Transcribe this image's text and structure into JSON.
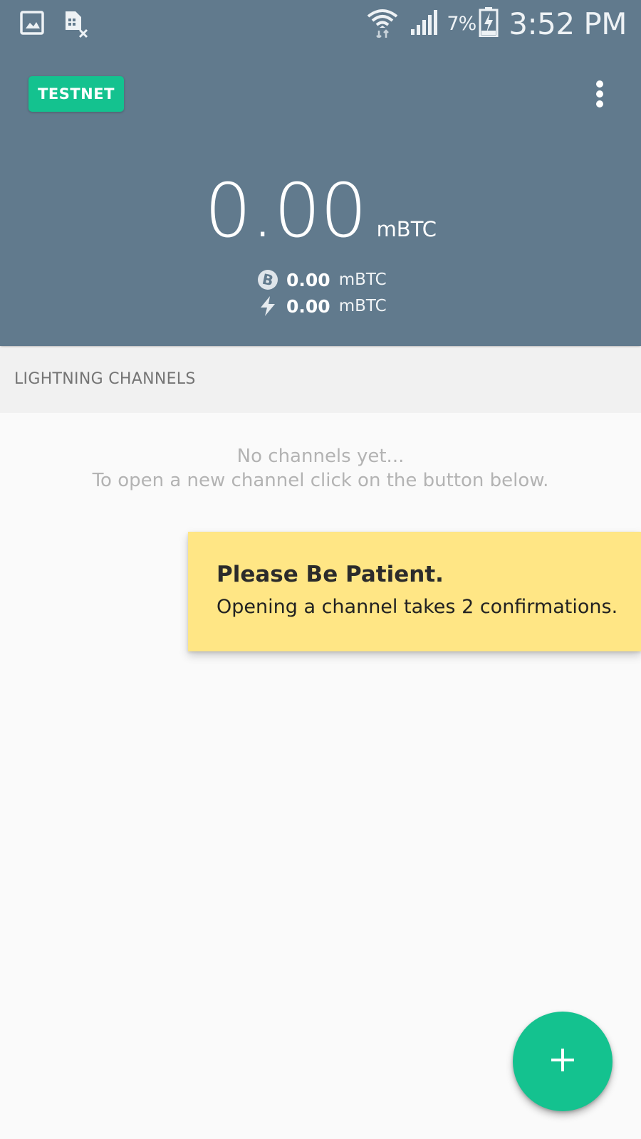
{
  "status_bar": {
    "left_icons": [
      "gallery-icon",
      "sim-card-off-icon"
    ],
    "right_icons": [
      "wifi-icon",
      "cell-signal-icon",
      "battery-charging-icon"
    ],
    "battery_percent": "7%",
    "time": "3:52 PM"
  },
  "header": {
    "network_badge": "TESTNET",
    "menu_icon": "more-vert-icon",
    "background_color": "#617a8d",
    "balance": {
      "value": "0.00",
      "unit": "mBTC"
    },
    "onchain": {
      "icon": "bitcoin-icon",
      "value": "0.00",
      "unit": "mBTC"
    },
    "lightning": {
      "icon": "lightning-bolt-icon",
      "value": "0.00",
      "unit": "mBTC"
    }
  },
  "channels": {
    "section_title": "LIGHTNING CHANNELS",
    "empty_line1": "No channels yet...",
    "empty_line2": "To open a new channel click on the button below."
  },
  "toast": {
    "title": "Please Be Patient.",
    "body": "Opening a channel takes 2 confirmations.",
    "background_color": "#ffe685"
  },
  "fab": {
    "icon": "plus-icon",
    "color": "#14c28f"
  }
}
